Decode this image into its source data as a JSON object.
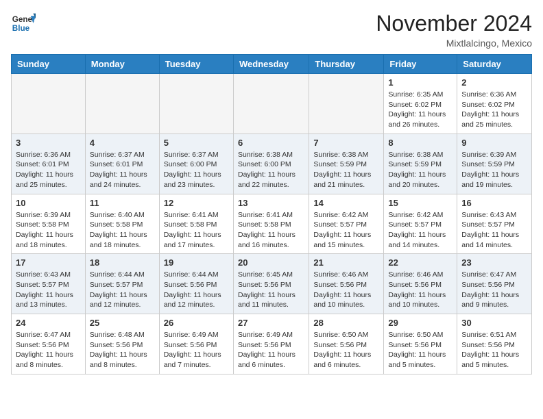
{
  "header": {
    "logo_general": "General",
    "logo_blue": "Blue",
    "month_title": "November 2024",
    "location": "Mixtlalcingo, Mexico"
  },
  "days_of_week": [
    "Sunday",
    "Monday",
    "Tuesday",
    "Wednesday",
    "Thursday",
    "Friday",
    "Saturday"
  ],
  "weeks": [
    [
      {
        "day": "",
        "info": ""
      },
      {
        "day": "",
        "info": ""
      },
      {
        "day": "",
        "info": ""
      },
      {
        "day": "",
        "info": ""
      },
      {
        "day": "",
        "info": ""
      },
      {
        "day": "1",
        "info": "Sunrise: 6:35 AM\nSunset: 6:02 PM\nDaylight: 11 hours and 26 minutes."
      },
      {
        "day": "2",
        "info": "Sunrise: 6:36 AM\nSunset: 6:02 PM\nDaylight: 11 hours and 25 minutes."
      }
    ],
    [
      {
        "day": "3",
        "info": "Sunrise: 6:36 AM\nSunset: 6:01 PM\nDaylight: 11 hours and 25 minutes."
      },
      {
        "day": "4",
        "info": "Sunrise: 6:37 AM\nSunset: 6:01 PM\nDaylight: 11 hours and 24 minutes."
      },
      {
        "day": "5",
        "info": "Sunrise: 6:37 AM\nSunset: 6:00 PM\nDaylight: 11 hours and 23 minutes."
      },
      {
        "day": "6",
        "info": "Sunrise: 6:38 AM\nSunset: 6:00 PM\nDaylight: 11 hours and 22 minutes."
      },
      {
        "day": "7",
        "info": "Sunrise: 6:38 AM\nSunset: 5:59 PM\nDaylight: 11 hours and 21 minutes."
      },
      {
        "day": "8",
        "info": "Sunrise: 6:38 AM\nSunset: 5:59 PM\nDaylight: 11 hours and 20 minutes."
      },
      {
        "day": "9",
        "info": "Sunrise: 6:39 AM\nSunset: 5:59 PM\nDaylight: 11 hours and 19 minutes."
      }
    ],
    [
      {
        "day": "10",
        "info": "Sunrise: 6:39 AM\nSunset: 5:58 PM\nDaylight: 11 hours and 18 minutes."
      },
      {
        "day": "11",
        "info": "Sunrise: 6:40 AM\nSunset: 5:58 PM\nDaylight: 11 hours and 18 minutes."
      },
      {
        "day": "12",
        "info": "Sunrise: 6:41 AM\nSunset: 5:58 PM\nDaylight: 11 hours and 17 minutes."
      },
      {
        "day": "13",
        "info": "Sunrise: 6:41 AM\nSunset: 5:58 PM\nDaylight: 11 hours and 16 minutes."
      },
      {
        "day": "14",
        "info": "Sunrise: 6:42 AM\nSunset: 5:57 PM\nDaylight: 11 hours and 15 minutes."
      },
      {
        "day": "15",
        "info": "Sunrise: 6:42 AM\nSunset: 5:57 PM\nDaylight: 11 hours and 14 minutes."
      },
      {
        "day": "16",
        "info": "Sunrise: 6:43 AM\nSunset: 5:57 PM\nDaylight: 11 hours and 14 minutes."
      }
    ],
    [
      {
        "day": "17",
        "info": "Sunrise: 6:43 AM\nSunset: 5:57 PM\nDaylight: 11 hours and 13 minutes."
      },
      {
        "day": "18",
        "info": "Sunrise: 6:44 AM\nSunset: 5:57 PM\nDaylight: 11 hours and 12 minutes."
      },
      {
        "day": "19",
        "info": "Sunrise: 6:44 AM\nSunset: 5:56 PM\nDaylight: 11 hours and 12 minutes."
      },
      {
        "day": "20",
        "info": "Sunrise: 6:45 AM\nSunset: 5:56 PM\nDaylight: 11 hours and 11 minutes."
      },
      {
        "day": "21",
        "info": "Sunrise: 6:46 AM\nSunset: 5:56 PM\nDaylight: 11 hours and 10 minutes."
      },
      {
        "day": "22",
        "info": "Sunrise: 6:46 AM\nSunset: 5:56 PM\nDaylight: 11 hours and 10 minutes."
      },
      {
        "day": "23",
        "info": "Sunrise: 6:47 AM\nSunset: 5:56 PM\nDaylight: 11 hours and 9 minutes."
      }
    ],
    [
      {
        "day": "24",
        "info": "Sunrise: 6:47 AM\nSunset: 5:56 PM\nDaylight: 11 hours and 8 minutes."
      },
      {
        "day": "25",
        "info": "Sunrise: 6:48 AM\nSunset: 5:56 PM\nDaylight: 11 hours and 8 minutes."
      },
      {
        "day": "26",
        "info": "Sunrise: 6:49 AM\nSunset: 5:56 PM\nDaylight: 11 hours and 7 minutes."
      },
      {
        "day": "27",
        "info": "Sunrise: 6:49 AM\nSunset: 5:56 PM\nDaylight: 11 hours and 6 minutes."
      },
      {
        "day": "28",
        "info": "Sunrise: 6:50 AM\nSunset: 5:56 PM\nDaylight: 11 hours and 6 minutes."
      },
      {
        "day": "29",
        "info": "Sunrise: 6:50 AM\nSunset: 5:56 PM\nDaylight: 11 hours and 5 minutes."
      },
      {
        "day": "30",
        "info": "Sunrise: 6:51 AM\nSunset: 5:56 PM\nDaylight: 11 hours and 5 minutes."
      }
    ]
  ]
}
